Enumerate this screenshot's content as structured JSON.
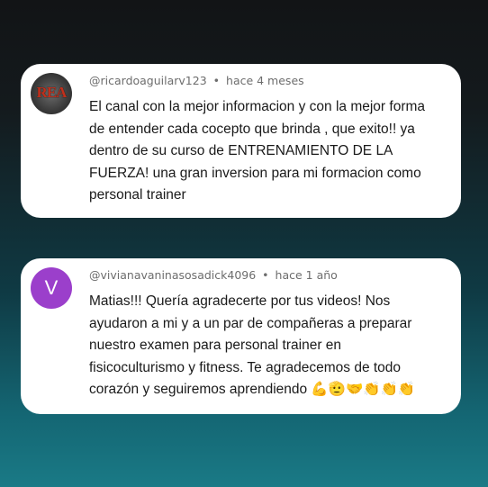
{
  "comments": [
    {
      "handle": "@ricardoaguilarv123",
      "separator": "•",
      "time": "hace 4 meses",
      "avatar_text": "REA",
      "lines": [
        "El canal con la mejor informacion y con la mejor forma",
        "de entender cada cocepto que brinda , que exito!! ya",
        "dentro de su curso de ENTRENAMIENTO DE LA",
        "FUERZA! una gran inversion para mi formacion como",
        "personal trainer"
      ]
    },
    {
      "handle": "@vivianavaninasosadick4096",
      "separator": "•",
      "time": "hace 1 año",
      "avatar_letter": "V",
      "avatar_color": "#9b3fcb",
      "lines": [
        "Matias!!! Quería agradecerte por tus videos! Nos",
        "ayudaron a mi y a un par de compañeras a preparar",
        "nuestro examen para personal trainer en",
        "fisicoculturismo y fitness. Te agradecemos de todo",
        "corazón y seguiremos aprendiendo 💪🫡🤝👏👏👏"
      ]
    }
  ]
}
